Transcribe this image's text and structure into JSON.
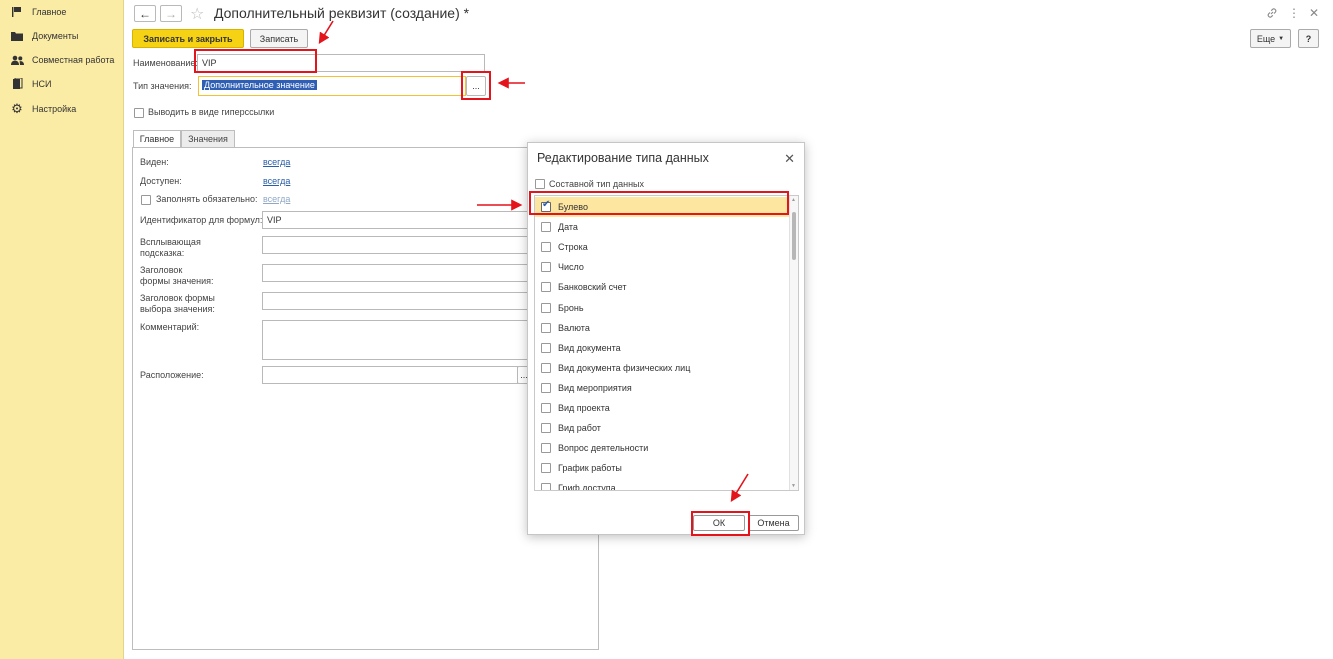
{
  "sidebar": {
    "items": [
      {
        "label": "Главное",
        "icon": "flag-icon"
      },
      {
        "label": "Документы",
        "icon": "folder-icon"
      },
      {
        "label": "Совместная работа",
        "icon": "users-icon"
      },
      {
        "label": "НСИ",
        "icon": "book-icon"
      },
      {
        "label": "Настройка",
        "icon": "gear-icon"
      }
    ]
  },
  "header": {
    "title": "Дополнительный реквизит (создание) *"
  },
  "toolbar": {
    "save_close_label": "Записать и закрыть",
    "save_label": "Записать",
    "more_label": "Еще",
    "help_label": "?"
  },
  "form": {
    "name_label": "Наименование:",
    "name_value": "VIP",
    "type_label": "Тип значения:",
    "type_value": "Дополнительное значение",
    "type_select_label": "...",
    "hyperlink_label": "Выводить в виде гиперссылки",
    "hyperlink_checked": false
  },
  "tabs": [
    {
      "label": "Главное",
      "active": true
    },
    {
      "label": "Значения",
      "active": false
    }
  ],
  "main_tab": {
    "visible_label": "Виден:",
    "visible_value": "всегда",
    "available_label": "Доступен:",
    "available_value": "всегда",
    "required_label": "Заполнять обязательно:",
    "required_value": "всегда",
    "formula_id_label": "Идентификатор для формул:",
    "formula_id_value": "VIP",
    "tooltip_label": "Всплывающая подсказка:",
    "tooltip_line1": "Всплывающая",
    "tooltip_line2": "подсказка:",
    "form_title_line1": "Заголовок",
    "form_title_line2": "формы значения:",
    "choice_title_line1": "Заголовок формы",
    "choice_title_line2": "выбора значения:",
    "comment_label": "Комментарий:",
    "location_label": "Расположение:",
    "location_select_label": "..."
  },
  "dialog": {
    "title": "Редактирование типа данных",
    "composite_label": "Составной тип данных",
    "composite_checked": false,
    "types": [
      {
        "label": "Булево",
        "checked": true
      },
      {
        "label": "Дата",
        "checked": false
      },
      {
        "label": "Строка",
        "checked": false
      },
      {
        "label": "Число",
        "checked": false
      },
      {
        "label": "Банковский счет",
        "checked": false
      },
      {
        "label": "Бронь",
        "checked": false
      },
      {
        "label": "Валюта",
        "checked": false
      },
      {
        "label": "Вид документа",
        "checked": false
      },
      {
        "label": "Вид документа физических лиц",
        "checked": false
      },
      {
        "label": "Вид мероприятия",
        "checked": false
      },
      {
        "label": "Вид проекта",
        "checked": false
      },
      {
        "label": "Вид работ",
        "checked": false
      },
      {
        "label": "Вопрос деятельности",
        "checked": false
      },
      {
        "label": "График работы",
        "checked": false
      },
      {
        "label": "Гриф доступа",
        "checked": false
      }
    ],
    "ok_label": "ОК",
    "cancel_label": "Отмена"
  },
  "colors": {
    "sidebar_bg": "#fbeca5",
    "primary_button": "#f5d314",
    "highlight": "#e3141b",
    "selection": "#fde6a0",
    "link": "#2a5ea8",
    "type_value_bg": "#2f5fb5"
  }
}
